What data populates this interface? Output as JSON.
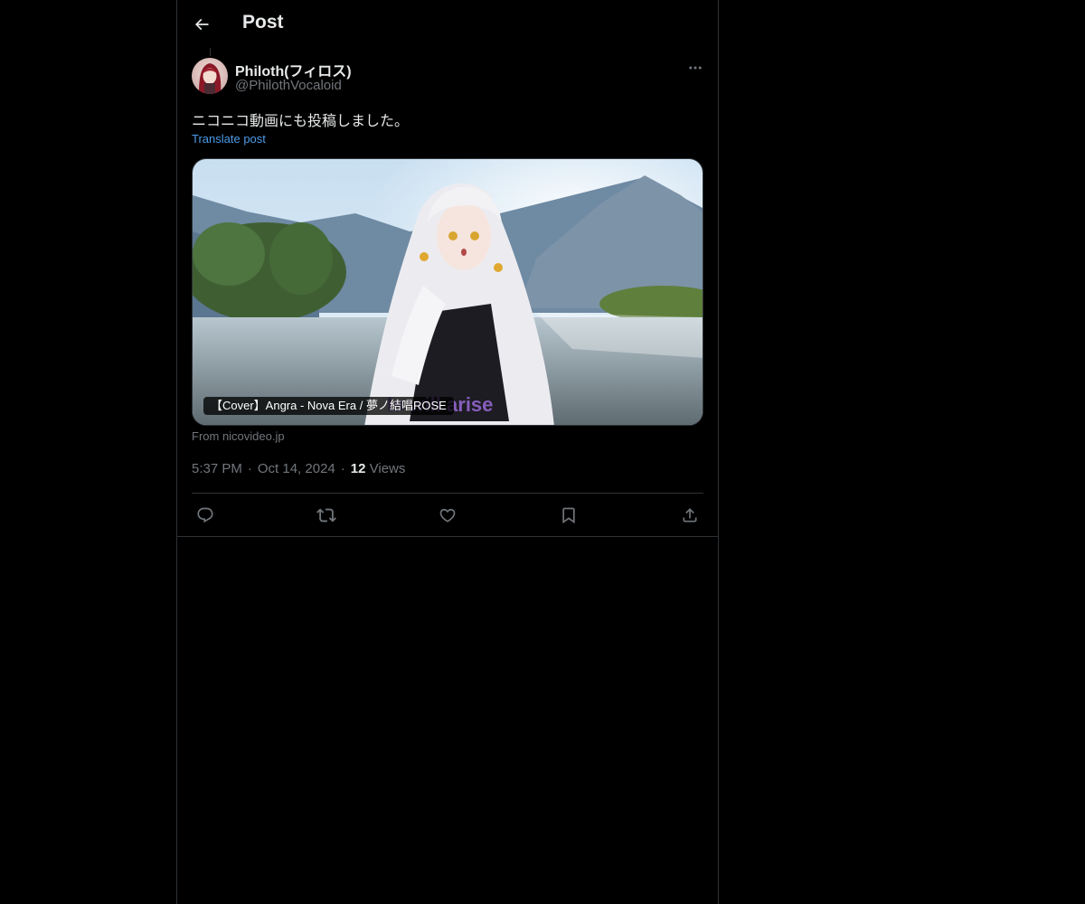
{
  "header": {
    "title": "Post",
    "back_icon": "arrow-left-icon"
  },
  "post": {
    "author": {
      "display_name": "Philoth(フィロス)",
      "handle": "@PhilothVocaloid",
      "avatar_icon": "avatar-image"
    },
    "more_icon": "more-horizontal-icon",
    "text": "ニコニコ動画にも投稿しました。",
    "translate_label": "Translate post",
    "media": {
      "caption": "【Cover】Angra - Nova Era / 夢ノ結唱ROSE",
      "lyric_overlay": "Is will arise",
      "source_label": "From nicovideo.jp"
    },
    "meta": {
      "time": "5:37 PM",
      "separator": "·",
      "date": "Oct 14, 2024",
      "views_count": "12",
      "views_label": "Views"
    },
    "actions": [
      {
        "name": "reply",
        "icon": "reply-icon"
      },
      {
        "name": "repost",
        "icon": "repost-icon"
      },
      {
        "name": "like",
        "icon": "heart-icon"
      },
      {
        "name": "bookmark",
        "icon": "bookmark-icon"
      },
      {
        "name": "share",
        "icon": "share-icon"
      }
    ]
  },
  "colors": {
    "background": "#000000",
    "text_primary": "#e7e9ea",
    "text_secondary": "#71767b",
    "link": "#4c9be8",
    "border": "#2f3336"
  }
}
